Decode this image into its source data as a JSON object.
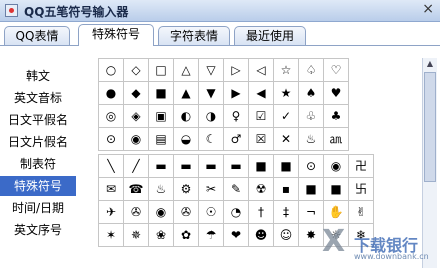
{
  "window": {
    "title": "QQ五笔符号输入器",
    "close_label": "×"
  },
  "tabs": [
    {
      "label": "QQ表情",
      "active": false
    },
    {
      "label": "特殊符号",
      "active": true
    },
    {
      "label": "字符表情",
      "active": false
    },
    {
      "label": "最近使用",
      "active": false
    }
  ],
  "sidebar": {
    "items": [
      {
        "label": "韩文"
      },
      {
        "label": "英文音标"
      },
      {
        "label": "日文平假名"
      },
      {
        "label": "日文片假名"
      },
      {
        "label": "制表符"
      },
      {
        "label": "特殊符号",
        "selected": true
      },
      {
        "label": "时间/日期"
      },
      {
        "label": "英文序号"
      }
    ]
  },
  "symbols_top": [
    [
      "○",
      "◇",
      "□",
      "△",
      "▽",
      "▷",
      "◁",
      "☆",
      "♤",
      "♡"
    ],
    [
      "●",
      "◆",
      "■",
      "▲",
      "▼",
      "▶",
      "◀",
      "★",
      "♠",
      "♥"
    ],
    [
      "◎",
      "◈",
      "▣",
      "◐",
      "◑",
      "♀",
      "☑",
      "✓",
      "♧",
      "♣"
    ],
    [
      "⊙",
      "◉",
      "▤",
      "◒",
      "☾",
      "♂",
      "☒",
      "✕",
      "♨",
      "㏂"
    ]
  ],
  "symbols_bottom": [
    [
      "╲",
      "╱",
      "▬",
      "▬",
      "▬",
      "▬",
      "■",
      "■",
      "⊙",
      "◉",
      "卍"
    ],
    [
      "✉",
      "☎",
      "♨",
      "⚙",
      "✂",
      "✎",
      "☢",
      "▪",
      "■",
      "■",
      "卐"
    ],
    [
      "✈",
      "✇",
      "◉",
      "✇",
      "☉",
      "◔",
      "†",
      "‡",
      "¬",
      "✋",
      "✌"
    ],
    [
      "✶",
      "✵",
      "❀",
      "✿",
      "☂",
      "❤",
      "☻",
      "☺",
      "✸",
      "☼",
      "❄"
    ]
  ],
  "scrollbar": {
    "up": "▲",
    "down": "▼"
  },
  "watermark": {
    "mark": "X",
    "text": "下载银行",
    "url": "www.downbank.cn"
  }
}
